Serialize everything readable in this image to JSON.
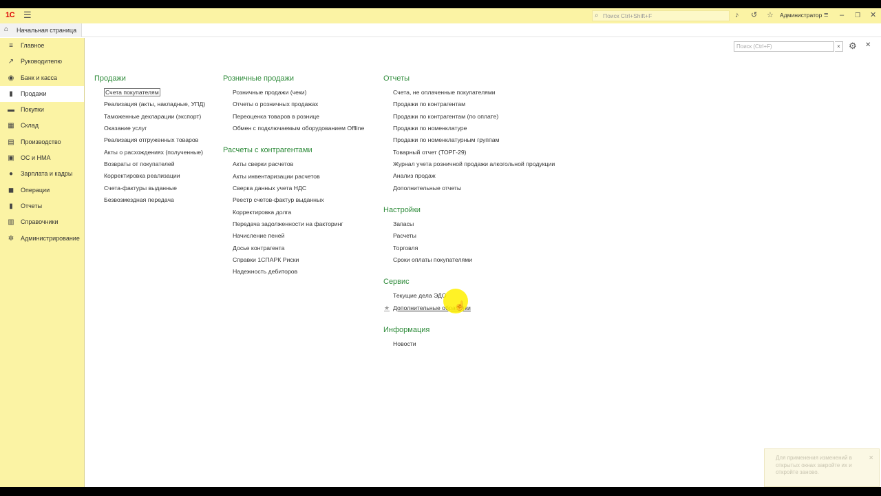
{
  "topbar": {
    "logo": "1С",
    "search_placeholder": "Поиск Ctrl+Shift+F",
    "user": "Администратор"
  },
  "home_tab": {
    "label": "Начальная страница"
  },
  "sidebar": {
    "items": [
      {
        "label": "Главное",
        "icon": "menu-lines-icon"
      },
      {
        "label": "Руководителю",
        "icon": "trend-icon"
      },
      {
        "label": "Банк и касса",
        "icon": "bank-icon"
      },
      {
        "label": "Продажи",
        "icon": "cart-icon",
        "active": true
      },
      {
        "label": "Покупки",
        "icon": "basket-icon"
      },
      {
        "label": "Склад",
        "icon": "warehouse-icon"
      },
      {
        "label": "Производство",
        "icon": "factory-icon"
      },
      {
        "label": "ОС и НМА",
        "icon": "assets-icon"
      },
      {
        "label": "Зарплата и кадры",
        "icon": "person-icon"
      },
      {
        "label": "Операции",
        "icon": "operations-icon"
      },
      {
        "label": "Отчеты",
        "icon": "chart-icon"
      },
      {
        "label": "Справочники",
        "icon": "book-icon"
      },
      {
        "label": "Администрирование",
        "icon": "gear-icon"
      }
    ]
  },
  "main": {
    "search_placeholder": "Поиск (Ctrl+F)",
    "col1": {
      "sections": [
        {
          "title": "Продажи",
          "links": [
            "Счета покупателям",
            "Реализация (акты, накладные, УПД)",
            "Таможенные декларации (экспорт)",
            "Оказание услуг",
            "Реализация отгруженных товаров",
            "Акты о расхождениях (полученные)",
            "Возвраты от покупателей",
            "Корректировка реализации",
            "Счета-фактуры выданные",
            "Безвозмездная передача"
          ]
        }
      ]
    },
    "col2": {
      "sections": [
        {
          "title": "Розничные продажи",
          "links": [
            "Розничные продажи (чеки)",
            "Отчеты о розничных продажах",
            "Переоценка товаров в рознице",
            "Обмен с подключаемым оборудованием Offline"
          ]
        },
        {
          "title": "Расчеты с контрагентами",
          "links": [
            "Акты сверки расчетов",
            "Акты инвентаризации расчетов",
            "Сверка данных учета НДС",
            "Реестр счетов-фактур выданных",
            "Корректировка долга",
            "Передача задолженности на факторинг",
            "Начисление пеней",
            "Досье контрагента",
            "Справки 1СПАРК Риски",
            "Надежность дебиторов"
          ]
        }
      ]
    },
    "col3": {
      "sections": [
        {
          "title": "Отчеты",
          "links": [
            "Счета, не оплаченные покупателями",
            "Продажи по контрагентам",
            "Продажи по контрагентам (по оплате)",
            "Продажи по номенклатуре",
            "Продажи по номенклатурным группам",
            "Товарный отчет (ТОРГ-29)",
            "Журнал учета розничной продажи алкогольной продукции",
            "Анализ продаж",
            "Дополнительные отчеты"
          ]
        },
        {
          "title": "Настройки",
          "links": [
            "Запасы",
            "Расчеты",
            "Торговля",
            "Сроки оплаты покупателями"
          ]
        },
        {
          "title": "Сервис",
          "links": [
            "Текущие дела ЭДО",
            "Дополнительные обработки"
          ]
        },
        {
          "title": "Информация",
          "links": [
            "Новости"
          ]
        }
      ]
    }
  },
  "notification": {
    "text": "Для применения изменений в открытых окнах закройте их и откройте заново."
  }
}
